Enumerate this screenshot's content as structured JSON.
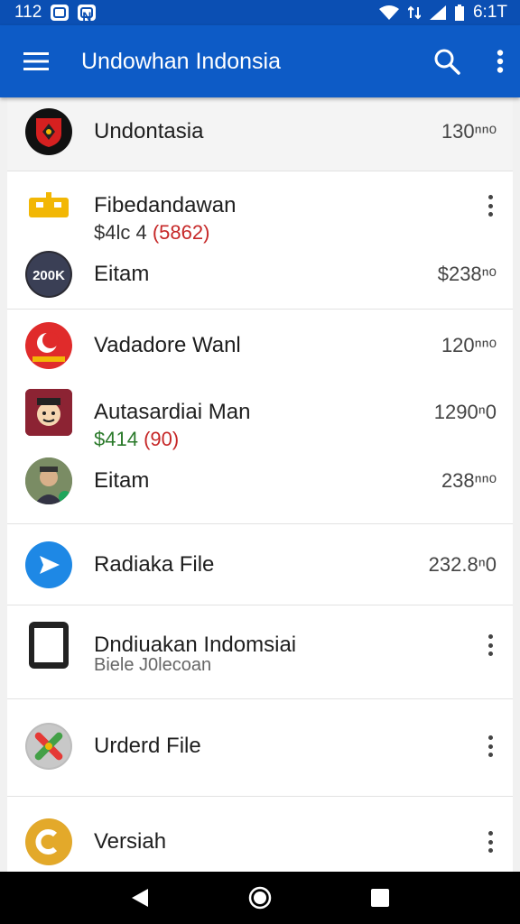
{
  "status_bar": {
    "time_left": "112",
    "badge_letter": "N",
    "time_right": "6:1T"
  },
  "app_bar": {
    "title": "Undowhan Indonsia",
    "menu_icon": "menu-icon",
    "search_icon": "search-icon",
    "overflow_icon": "more-vert-icon"
  },
  "items": [
    {
      "label": "Undontasia",
      "value": "130ⁿⁿᵒ"
    },
    {
      "label": "Fibedandawan",
      "price": "$4lc 4",
      "price_note": "(5862)",
      "sub_label": "Eitam",
      "sub_value": "$238ⁿᵒ"
    },
    {
      "label": "Vadadore Wanl",
      "value": "120ⁿⁿᵒ"
    },
    {
      "label": "Autasardiai Man",
      "value": "1290ⁿ0",
      "price": "$414",
      "price_note": "(90)",
      "sub_label": "Eitam",
      "sub_value": "238ⁿⁿᵒ"
    },
    {
      "label": "Radiaka File",
      "value": "232.8ⁿ0"
    },
    {
      "label": "Dndiuakan Indomsiai",
      "sub": "Biele J0lecoan"
    },
    {
      "label": "Urderd File"
    },
    {
      "label": "Versiah"
    }
  ],
  "colors": {
    "app_bar": "#0d5bc6",
    "status_bar": "#0b4fb3",
    "price_green": "#2b7a2b",
    "price_red": "#c62828"
  }
}
